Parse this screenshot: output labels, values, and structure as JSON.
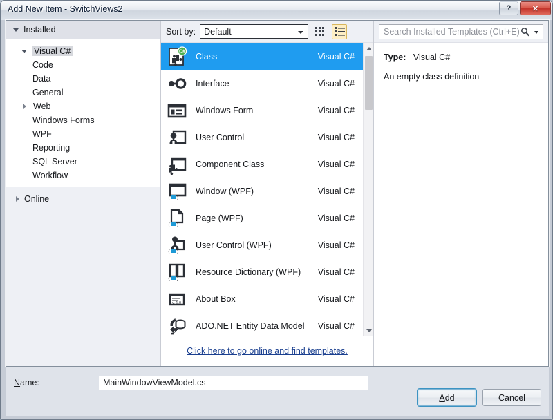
{
  "window": {
    "title": "Add New Item - SwitchViews2",
    "help_button": "?",
    "close_button": "✕"
  },
  "left_panel": {
    "installed_header": "Installed",
    "root": {
      "label": "Visual C#"
    },
    "categories": [
      {
        "label": "Code"
      },
      {
        "label": "Data"
      },
      {
        "label": "General"
      },
      {
        "label": "Web"
      },
      {
        "label": "Windows Forms"
      },
      {
        "label": "WPF"
      },
      {
        "label": "Reporting"
      },
      {
        "label": "SQL Server"
      },
      {
        "label": "Workflow"
      }
    ],
    "online": "Online"
  },
  "toolbar": {
    "sort_label": "Sort by:",
    "sort_value": "Default",
    "view_medium_icons": "medium-icons-view",
    "view_list": "list-view"
  },
  "templates": [
    {
      "name": "Class",
      "lang": "Visual C#",
      "icon": "class-icon",
      "selected": true
    },
    {
      "name": "Interface",
      "lang": "Visual C#",
      "icon": "interface-icon",
      "selected": false
    },
    {
      "name": "Windows Form",
      "lang": "Visual C#",
      "icon": "windows-form-icon",
      "selected": false
    },
    {
      "name": "User Control",
      "lang": "Visual C#",
      "icon": "user-control-icon",
      "selected": false
    },
    {
      "name": "Component Class",
      "lang": "Visual C#",
      "icon": "component-class-icon",
      "selected": false
    },
    {
      "name": "Window (WPF)",
      "lang": "Visual C#",
      "icon": "wpf-window-icon",
      "selected": false
    },
    {
      "name": "Page (WPF)",
      "lang": "Visual C#",
      "icon": "wpf-page-icon",
      "selected": false
    },
    {
      "name": "User Control (WPF)",
      "lang": "Visual C#",
      "icon": "wpf-user-control-icon",
      "selected": false
    },
    {
      "name": "Resource Dictionary (WPF)",
      "lang": "Visual C#",
      "icon": "wpf-resource-dictionary-icon",
      "selected": false
    },
    {
      "name": "About Box",
      "lang": "Visual C#",
      "icon": "about-box-icon",
      "selected": false
    },
    {
      "name": "ADO.NET Entity Data Model",
      "lang": "Visual C#",
      "icon": "ado-net-entity-data-model-icon",
      "selected": false
    }
  ],
  "online_templates_link": "Click here to go online and find templates.",
  "search": {
    "placeholder": "Search Installed Templates (Ctrl+E)",
    "value": ""
  },
  "preview": {
    "type_label": "Type:",
    "type_value": "Visual C#",
    "description": "An empty class definition"
  },
  "footer": {
    "name_label_prefix": "",
    "name_label_accel": "N",
    "name_label_suffix": "ame:",
    "name_value": "MainWindowViewModel.cs",
    "add_accel": "A",
    "add_suffix": "dd",
    "cancel_label": "Cancel"
  },
  "colors": {
    "selection_blue": "#1f9cf0",
    "link_blue": "#1a3f8f",
    "active_toggle": "#fdeec4",
    "csharp_badge_green": "#4caf50",
    "xaml_badge_blue": "#1e9ad6"
  }
}
